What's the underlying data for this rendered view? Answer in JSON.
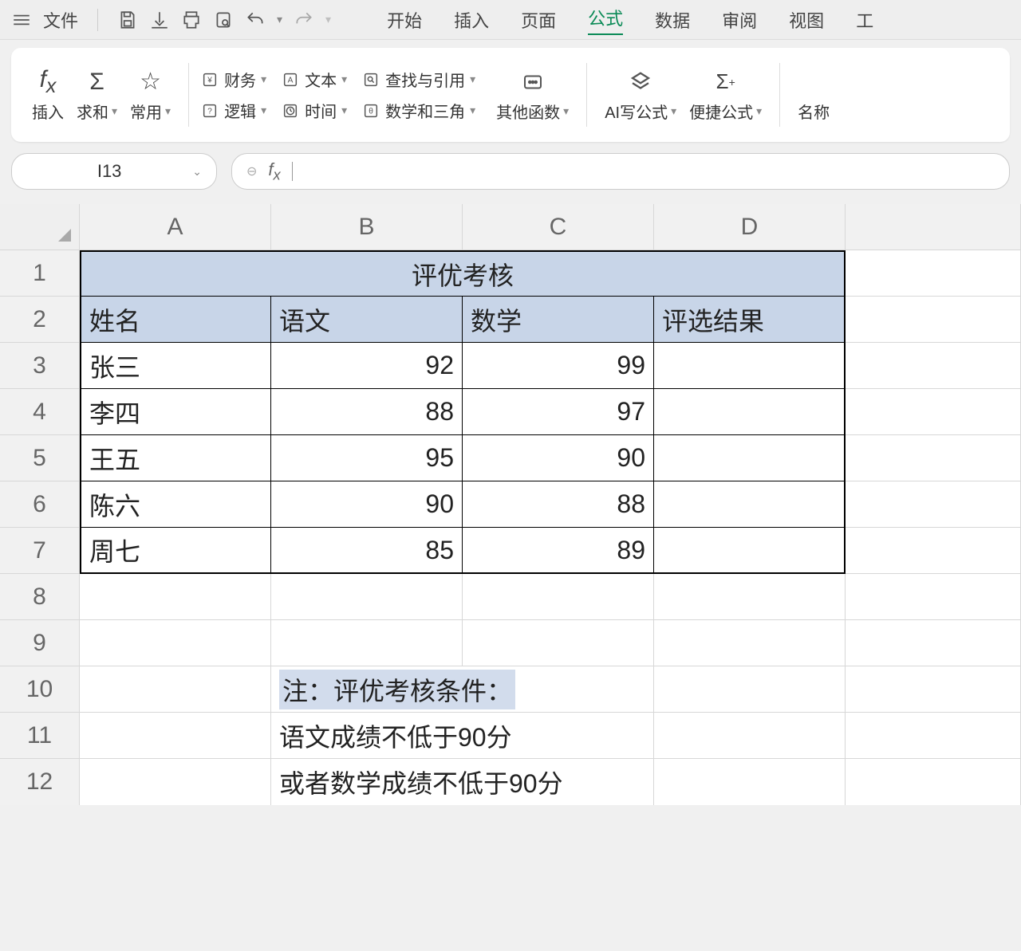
{
  "menubar": {
    "file": "文件",
    "tabs": [
      "开始",
      "插入",
      "页面",
      "公式",
      "数据",
      "审阅",
      "视图"
    ],
    "active_index": 3,
    "trailing": "工"
  },
  "ribbon": {
    "insert": "插入",
    "sum": "求和",
    "common": "常用",
    "finance": "财务",
    "text": "文本",
    "lookup": "查找与引用",
    "logic": "逻辑",
    "time": "时间",
    "math": "数学和三角",
    "other": "其他函数",
    "ai": "AI写公式",
    "quick": "便捷公式",
    "name": "名称"
  },
  "formula_bar": {
    "cell_ref": "I13"
  },
  "sheet": {
    "columns": [
      "A",
      "B",
      "C",
      "D"
    ],
    "rows": [
      "1",
      "2",
      "3",
      "4",
      "5",
      "6",
      "7",
      "8",
      "9",
      "10",
      "11",
      "12"
    ],
    "title": "评优考核",
    "headers": {
      "name": "姓名",
      "chinese": "语文",
      "math": "数学",
      "result": "评选结果"
    },
    "data": [
      {
        "name": "张三",
        "chinese": 92,
        "math": 99
      },
      {
        "name": "李四",
        "chinese": 88,
        "math": 97
      },
      {
        "name": "王五",
        "chinese": 95,
        "math": 90
      },
      {
        "name": "陈六",
        "chinese": 90,
        "math": 88
      },
      {
        "name": "周七",
        "chinese": 85,
        "math": 89
      }
    ],
    "note_label": "注：评优考核条件：",
    "note_line1": "语文成绩不低于90分",
    "note_line2": "或者数学成绩不低于90分"
  }
}
